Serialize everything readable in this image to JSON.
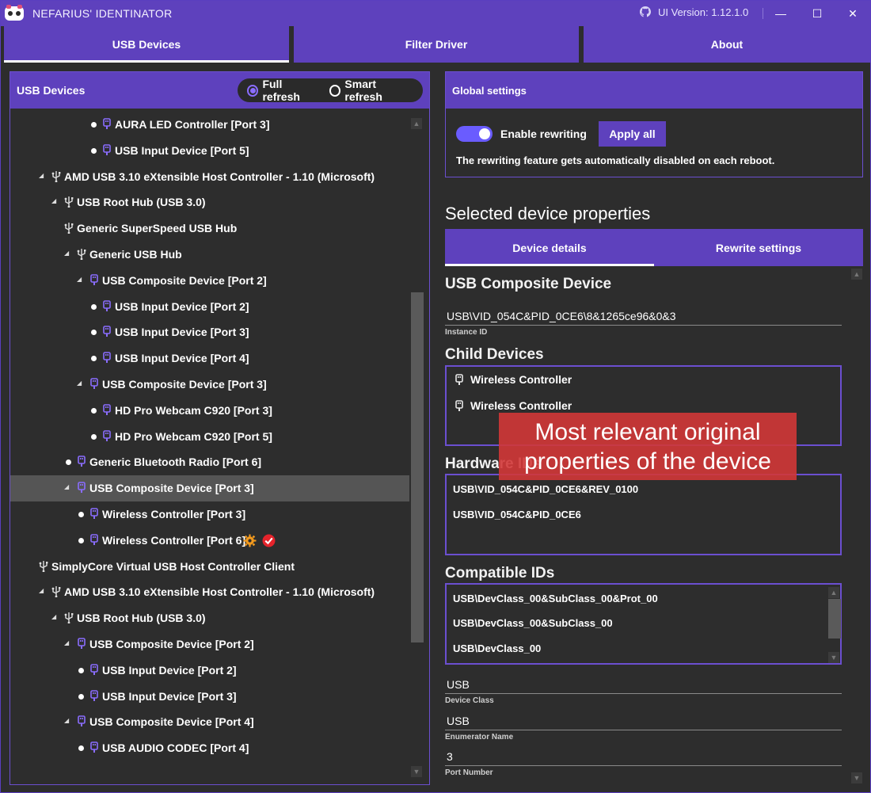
{
  "window": {
    "title": "NEFARIUS' IDENTINATOR",
    "version": "UI Version: 1.12.1.0",
    "minimize_glyph": "—",
    "maximize_glyph": "☐",
    "close_glyph": "✕"
  },
  "main_tabs": [
    {
      "label": "USB Devices",
      "active": true
    },
    {
      "label": "Filter Driver",
      "active": false
    },
    {
      "label": "About",
      "active": false
    }
  ],
  "left_panel": {
    "title": "USB Devices",
    "refresh_options": [
      {
        "label": "Full refresh",
        "checked": true
      },
      {
        "label": "Smart refresh",
        "checked": false
      }
    ]
  },
  "tree": [
    {
      "label": "AURA LED Controller [Port 3]",
      "depth": 5,
      "kind": "leaf",
      "icon": "usb-device-icon"
    },
    {
      "label": "USB Input Device [Port 5]",
      "depth": 5,
      "kind": "leaf",
      "icon": "usb-device-icon"
    },
    {
      "label": "AMD USB 3.10 eXtensible Host Controller - 1.10 (Microsoft)",
      "depth": 1,
      "kind": "expanded",
      "icon": "usb-hub-icon"
    },
    {
      "label": "USB Root Hub (USB 3.0)",
      "depth": 2,
      "kind": "expanded",
      "icon": "usb-hub-icon"
    },
    {
      "label": "Generic SuperSpeed USB Hub",
      "depth": 2,
      "kind": "none",
      "icon": "usb-hub-icon"
    },
    {
      "label": "Generic USB Hub",
      "depth": 3,
      "kind": "expanded",
      "icon": "usb-hub-icon"
    },
    {
      "label": "USB Composite Device [Port 2]",
      "depth": 4,
      "kind": "expanded",
      "icon": "usb-device-icon"
    },
    {
      "label": "USB Input Device [Port 2]",
      "depth": 5,
      "kind": "leaf",
      "icon": "usb-device-icon"
    },
    {
      "label": "USB Input Device [Port 3]",
      "depth": 5,
      "kind": "leaf",
      "icon": "usb-device-icon"
    },
    {
      "label": "USB Input Device [Port 4]",
      "depth": 5,
      "kind": "leaf",
      "icon": "usb-device-icon"
    },
    {
      "label": "USB Composite Device [Port 3]",
      "depth": 4,
      "kind": "expanded",
      "icon": "usb-device-icon"
    },
    {
      "label": "HD Pro Webcam C920 [Port 3]",
      "depth": 5,
      "kind": "leaf",
      "icon": "usb-device-icon"
    },
    {
      "label": "HD Pro Webcam C920 [Port 5]",
      "depth": 5,
      "kind": "leaf",
      "icon": "usb-device-icon"
    },
    {
      "label": "Generic Bluetooth Radio [Port 6]",
      "depth": 3,
      "kind": "leaf",
      "icon": "usb-device-icon"
    },
    {
      "label": "USB Composite Device [Port 3]",
      "depth": 3,
      "kind": "expanded",
      "icon": "usb-device-icon",
      "selected": true
    },
    {
      "label": "Wireless Controller [Port 3]",
      "depth": 4,
      "kind": "leaf",
      "icon": "usb-device-icon"
    },
    {
      "label": "Wireless Controller [Port 6]",
      "depth": 4,
      "kind": "leaf",
      "icon": "usb-device-icon",
      "badges": [
        "gear-icon",
        "check-badge-icon"
      ]
    },
    {
      "label": "SimplyCore Virtual USB Host Controller Client",
      "depth": 0,
      "kind": "none",
      "icon": "usb-hub-icon"
    },
    {
      "label": "AMD USB 3.10 eXtensible Host Controller - 1.10 (Microsoft)",
      "depth": 1,
      "kind": "expanded",
      "icon": "usb-hub-icon"
    },
    {
      "label": "USB Root Hub (USB 3.0)",
      "depth": 2,
      "kind": "expanded",
      "icon": "usb-hub-icon"
    },
    {
      "label": "USB Composite Device [Port 2]",
      "depth": 3,
      "kind": "expanded",
      "icon": "usb-device-icon"
    },
    {
      "label": "USB Input Device [Port 2]",
      "depth": 4,
      "kind": "leaf",
      "icon": "usb-device-icon"
    },
    {
      "label": "USB Input Device [Port 3]",
      "depth": 4,
      "kind": "leaf",
      "icon": "usb-device-icon"
    },
    {
      "label": "USB Composite Device [Port 4]",
      "depth": 3,
      "kind": "expanded",
      "icon": "usb-device-icon"
    },
    {
      "label": "USB AUDIO  CODEC [Port 4]",
      "depth": 4,
      "kind": "leaf",
      "icon": "usb-device-icon"
    }
  ],
  "global_settings": {
    "title": "Global settings",
    "toggle_label": "Enable rewriting",
    "toggle_on": true,
    "apply_label": "Apply all",
    "note": "The rewriting feature gets automatically disabled on each reboot."
  },
  "selected_device": {
    "section_title": "Selected device properties",
    "tabs": [
      {
        "label": "Device details",
        "active": true
      },
      {
        "label": "Rewrite settings",
        "active": false
      }
    ],
    "name": "USB Composite Device",
    "instance_id": "USB\\VID_054C&PID_0CE6\\8&1265ce96&0&3",
    "instance_id_caption": "Instance ID",
    "child_devices_title": "Child Devices",
    "child_devices": [
      "Wireless Controller",
      "Wireless Controller"
    ],
    "hardware_ids_title": "Hardware IDs",
    "hardware_ids": [
      "USB\\VID_054C&PID_0CE6&REV_0100",
      "USB\\VID_054C&PID_0CE6"
    ],
    "compatible_ids_title": "Compatible IDs",
    "compatible_ids": [
      "USB\\DevClass_00&SubClass_00&Prot_00",
      "USB\\DevClass_00&SubClass_00",
      "USB\\DevClass_00"
    ],
    "device_class": "USB",
    "device_class_caption": "Device Class",
    "enumerator_name": "USB",
    "enumerator_name_caption": "Enumerator Name",
    "port_number": "3",
    "port_number_caption": "Port Number"
  },
  "callout": {
    "text": "Most relevant original properties of the device"
  },
  "colors": {
    "accent": "#5e41bd",
    "background": "#2d2d2d",
    "selected_row": "#555555",
    "toggle": "#6a5cff",
    "callout": "#d23737",
    "gear": "#f29a1e",
    "check": "#e5232b"
  }
}
